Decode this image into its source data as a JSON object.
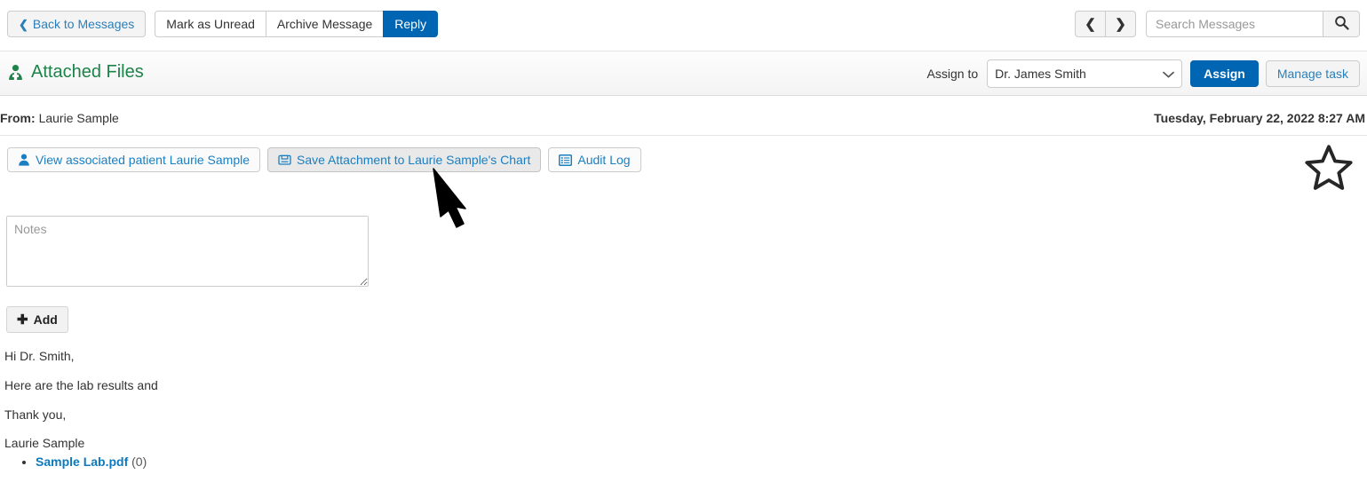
{
  "toolbar": {
    "back_label": "Back to Messages",
    "back_icon": "chevron-left-icon",
    "mark_unread_label": "Mark as Unread",
    "archive_label": "Archive Message",
    "reply_label": "Reply",
    "prev_icon": "chevron-left-icon",
    "next_icon": "chevron-right-icon",
    "search_placeholder": "Search Messages",
    "search_value": "",
    "search_icon": "search-icon"
  },
  "panel": {
    "title": "Attached Files",
    "title_icon": "user-md-icon",
    "title_color": "#1d8348",
    "assign_to_label": "Assign to",
    "assignee_selected": "Dr. James Smith",
    "assignee_options": [
      "Dr. James Smith"
    ],
    "assign_button_label": "Assign",
    "assign_button_color": "#0066b3",
    "manage_task_label": "Manage task"
  },
  "message": {
    "from_label": "From:",
    "from_name": "Laurie Sample",
    "date": "Tuesday, February 22, 2022 8:27 AM",
    "star_icon": "star-outline-icon",
    "body": [
      "Hi Dr. Smith,",
      "Here are the lab results and",
      "Thank you,",
      "Laurie Sample"
    ],
    "attachments": [
      {
        "name": "Sample Lab.pdf",
        "count": "(0)"
      }
    ]
  },
  "actions": [
    {
      "label": "View associated patient Laurie Sample",
      "icon": "user-icon",
      "hover": false
    },
    {
      "label": "Save Attachment to Laurie Sample's Chart",
      "icon": "save-icon",
      "hover": true
    },
    {
      "label": "Audit Log",
      "icon": "list-alt-icon",
      "hover": false
    }
  ],
  "notes": {
    "placeholder": "Notes",
    "value": "",
    "add_label": "Add",
    "add_icon": "plus-icon"
  },
  "cursor": {
    "icon": "mouse-pointer-arrow"
  }
}
